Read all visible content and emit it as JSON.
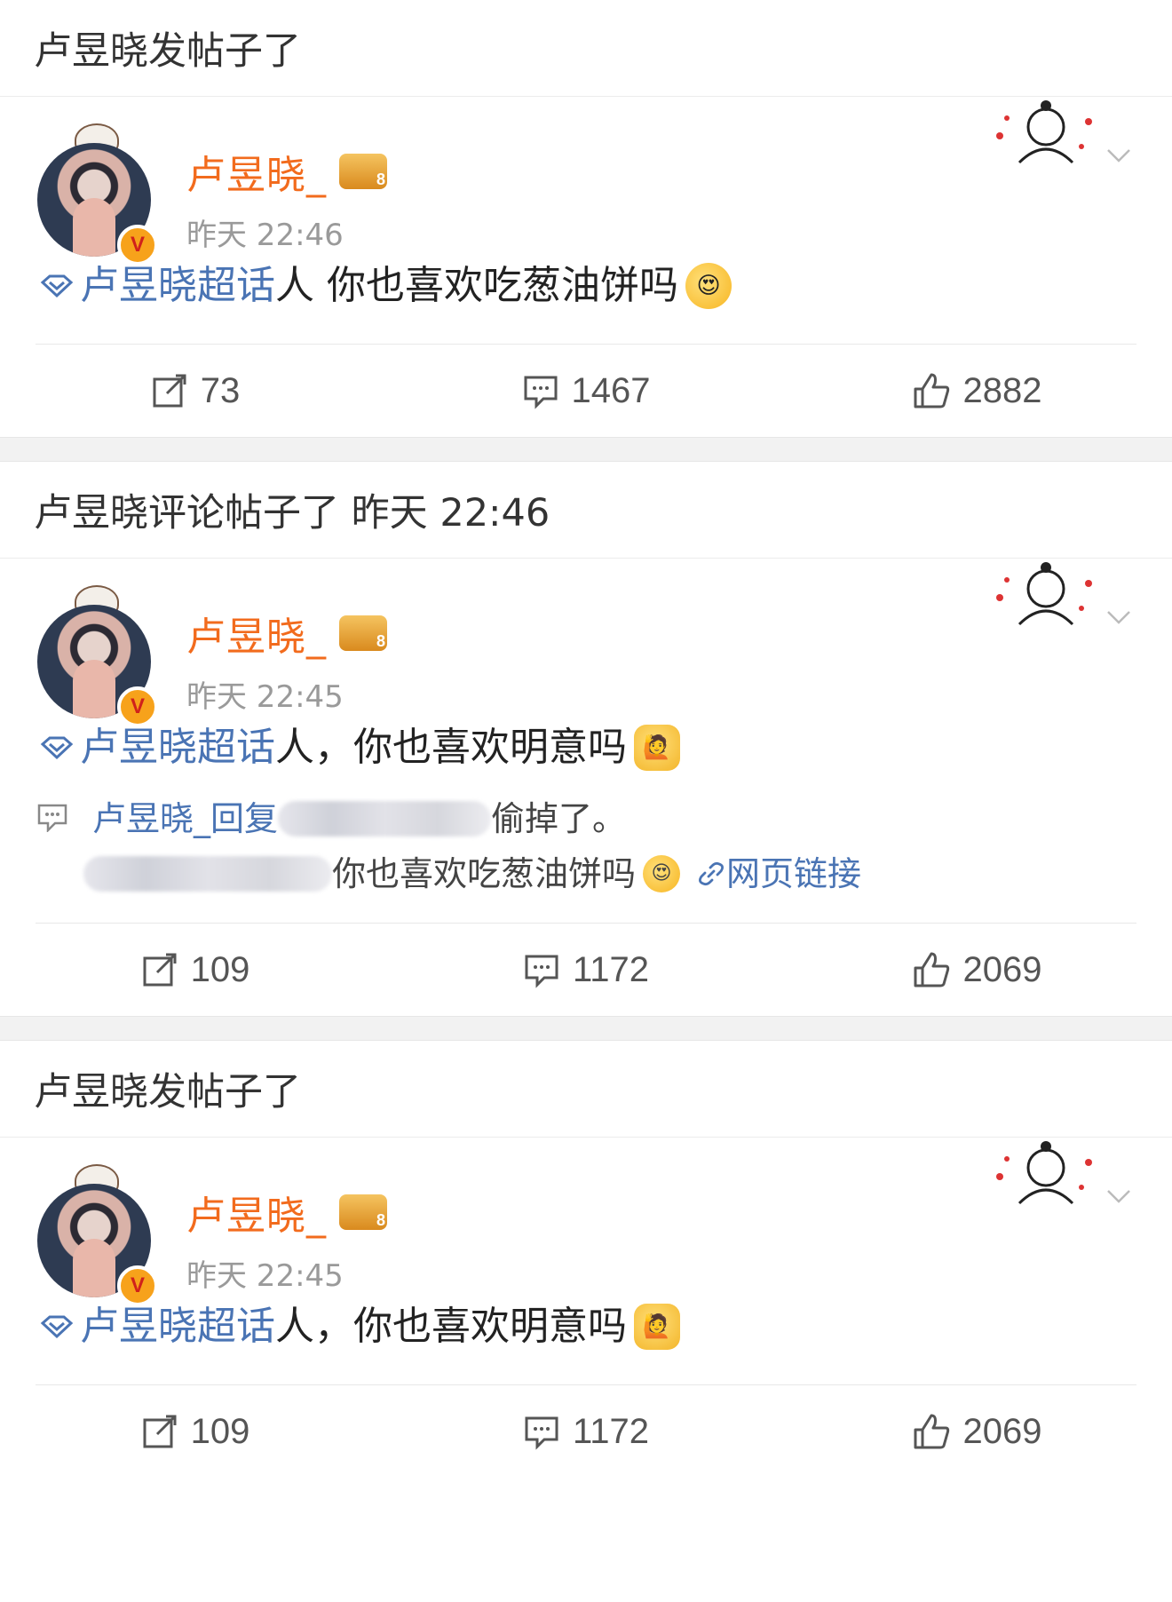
{
  "posts": [
    {
      "header": "卢昱晓发帖子了",
      "username": "卢昱晓_",
      "time": "昨天 22:46",
      "topic": "卢昱晓超话",
      "text": " 人 你也喜欢吃葱油饼吗",
      "emoji": "😍",
      "reposts": "73",
      "comments": "1467",
      "likes": "2882"
    },
    {
      "header": "卢昱晓评论帖子了 昨天 22:46",
      "username": "卢昱晓_",
      "time": "昨天 22:45",
      "topic": "卢昱晓超话",
      "text": " 人，你也喜欢明意吗",
      "emoji": "🙋",
      "reply": {
        "author": "卢昱晓_回复",
        "suffix": "偷掉了。",
        "line2": "你也喜欢吃葱油饼吗",
        "emoji": "😍",
        "link": "网页链接"
      },
      "reposts": "109",
      "comments": "1172",
      "likes": "2069"
    },
    {
      "header": "卢昱晓发帖子了",
      "username": "卢昱晓_",
      "time": "昨天 22:45",
      "topic": "卢昱晓超话",
      "text": " 人，你也喜欢明意吗",
      "emoji": "🙋",
      "reposts": "109",
      "comments": "1172",
      "likes": "2069"
    }
  ],
  "icons": {
    "badge_letter": "V"
  },
  "colors": {
    "username": "#f26b1d",
    "link": "#4a74b4",
    "badge": "#f7a21b"
  }
}
